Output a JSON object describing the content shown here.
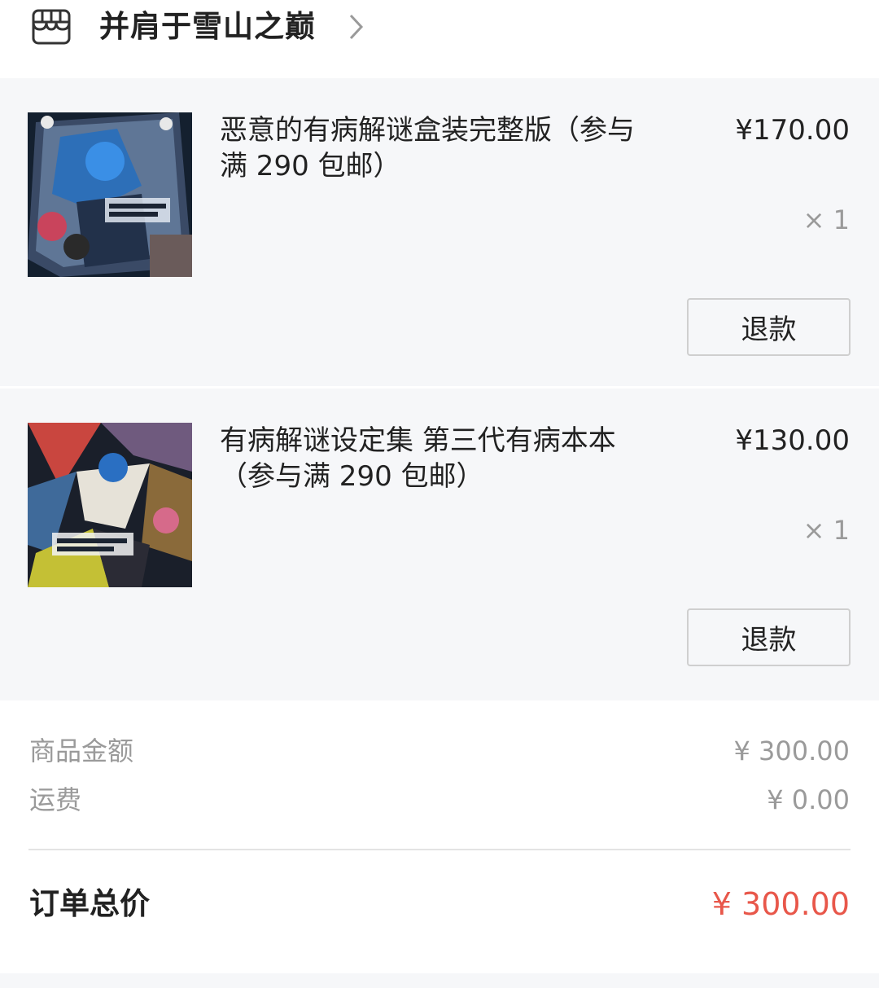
{
  "shop": {
    "name": "并肩于雪山之巅",
    "icon": "shop-icon"
  },
  "items": [
    {
      "title": "恶意的有病解谜盒装完整版（参与满 290 包邮）",
      "price": "¥170.00",
      "quantity": "× 1",
      "refund_label": "退款",
      "thumbnail": "product-image"
    },
    {
      "title": "有病解谜设定集 第三代有病本本（参与满 290 包邮）",
      "price": "¥130.00",
      "quantity": "× 1",
      "refund_label": "退款",
      "thumbnail": "product-image"
    }
  ],
  "summary": {
    "goods_label": "商品金额",
    "goods_value": "¥ 300.00",
    "shipping_label": "运费",
    "shipping_value": "¥ 0.00",
    "total_label": "订单总价",
    "total_value": "¥ 300.00"
  },
  "colors": {
    "background": "#ffffff",
    "item_background": "#f6f7f9",
    "muted_text": "#9a9a9a",
    "total_accent": "#e8574a"
  }
}
